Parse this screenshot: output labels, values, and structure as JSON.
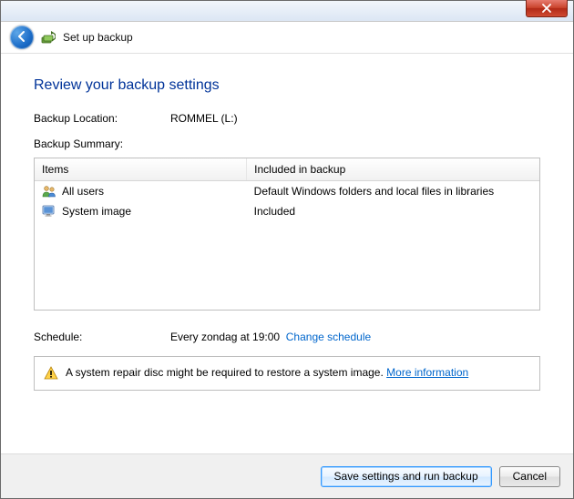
{
  "titlebar": {},
  "nav": {
    "title": "Set up backup"
  },
  "heading": "Review your backup settings",
  "location": {
    "label": "Backup Location:",
    "value": "ROMMEL (L:)"
  },
  "summary": {
    "label": "Backup Summary:",
    "columns": [
      "Items",
      "Included in backup"
    ],
    "rows": [
      {
        "icon": "users-icon",
        "item": "All users",
        "included": "Default Windows folders and local files in libraries"
      },
      {
        "icon": "monitor-icon",
        "item": "System image",
        "included": "Included"
      }
    ]
  },
  "schedule": {
    "label": "Schedule:",
    "value": "Every zondag at 19:00",
    "change_link": "Change schedule"
  },
  "info": {
    "text": "A system repair disc might be required to restore a system image. ",
    "link": "More information"
  },
  "footer": {
    "primary": "Save settings and run backup",
    "cancel": "Cancel"
  }
}
